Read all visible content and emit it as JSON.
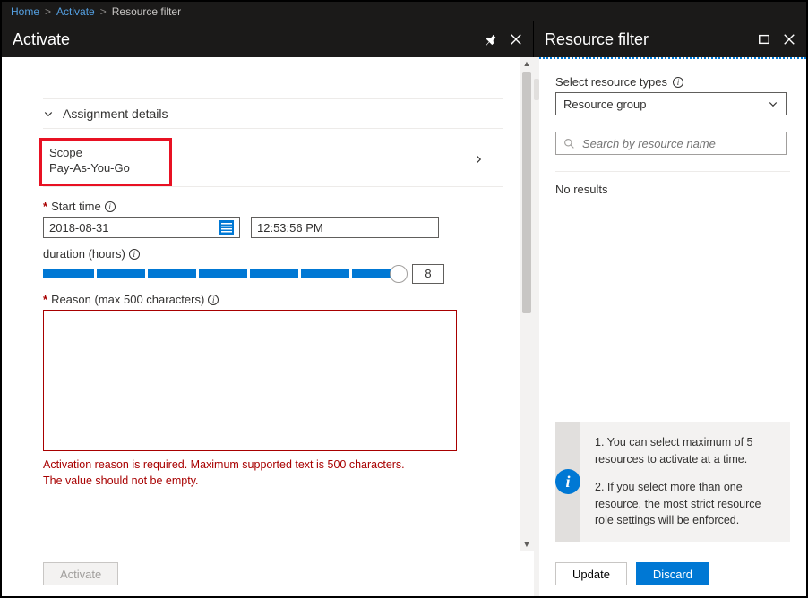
{
  "breadcrumb": {
    "home": "Home",
    "activate": "Activate",
    "current": "Resource filter"
  },
  "blades": {
    "left_title": "Activate",
    "right_title": "Resource filter"
  },
  "assignment": {
    "section_title": "Assignment details",
    "scope_label": "Scope",
    "scope_value": "Pay-As-You-Go",
    "start_time_label": "Start time",
    "date_value": "2018-08-31",
    "time_value": "12:53:56 PM",
    "duration_label": "duration (hours)",
    "duration_value": "8",
    "reason_label": "Reason (max 500 characters)",
    "reason_value": "",
    "error_line1": "Activation reason is required. Maximum supported text is 500 characters.",
    "error_line2": "The value should not be empty.",
    "activate_btn": "Activate"
  },
  "filter": {
    "types_label": "Select resource types",
    "types_value": "Resource group",
    "search_placeholder": "Search by resource name",
    "no_results": "No results",
    "tip1": "1. You can select maximum of 5 resources to activate at a time.",
    "tip2": "2. If you select more than one resource, the most strict resource role settings will be enforced.",
    "update_btn": "Update",
    "discard_btn": "Discard"
  }
}
